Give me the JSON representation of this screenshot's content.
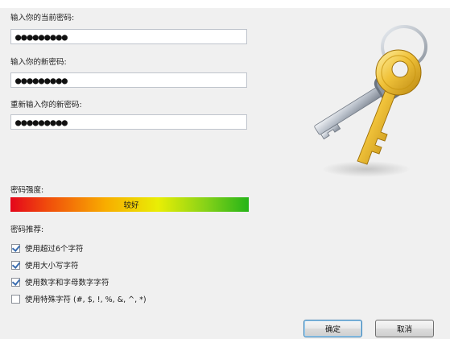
{
  "form": {
    "current_label": "输入你的当前密码:",
    "current_value": "●●●●●●●●●",
    "new_label": "输入你的新密码:",
    "new_value": "●●●●●●●●●",
    "confirm_label": "重新输入你的新密码:",
    "confirm_value": "●●●●●●●●●"
  },
  "strength": {
    "label": "密码强度:",
    "value_text": "较好"
  },
  "recommendations": {
    "label": "密码推荐:",
    "items": [
      {
        "label": "使用超过6个字符",
        "checked": true
      },
      {
        "label": "使用大小写字符",
        "checked": true
      },
      {
        "label": "使用数字和字母数字字符",
        "checked": true
      },
      {
        "label": "使用特殊字符 (#, $, !, %, &, ^, *)",
        "checked": false
      }
    ]
  },
  "buttons": {
    "ok": "确定",
    "cancel": "取消"
  },
  "icons": {
    "illustration": "keys-icon"
  }
}
